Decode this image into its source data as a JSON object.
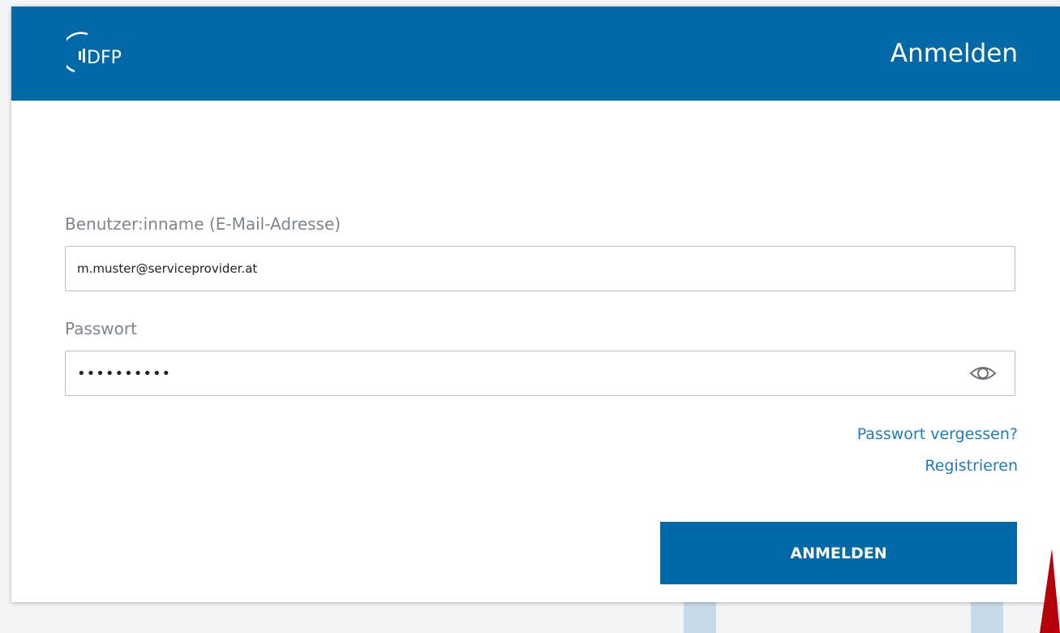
{
  "header": {
    "logo_text": "DFP",
    "title": "Anmelden"
  },
  "form": {
    "username": {
      "label": "Benutzer:inname (E-Mail-Adresse)",
      "value": "m.muster@serviceprovider.at"
    },
    "password": {
      "label": "Passwort",
      "value": "••••••••••",
      "toggle_icon": "eye-icon"
    },
    "links": {
      "forgot": "Passwort vergessen?",
      "register": "Registrieren"
    },
    "submit_label": "ANMELDEN"
  },
  "colors": {
    "brand": "#0169a8",
    "link": "#1a7cc1",
    "label": "#7b8590",
    "annotation_arrow": "#b3000a"
  }
}
